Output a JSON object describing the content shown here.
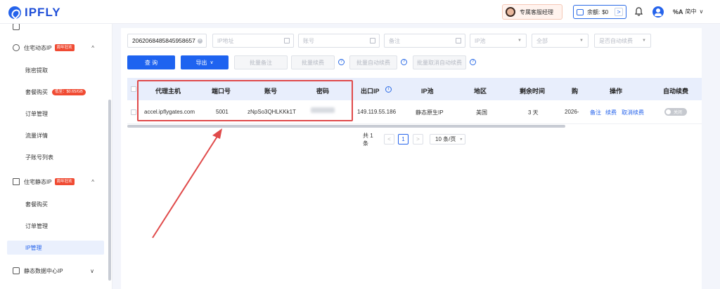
{
  "header": {
    "logo_text": "IPFLY",
    "service_label": "专属客服经理",
    "balance_label": "余额:",
    "balance_value": "$0",
    "balance_arrow": ">",
    "language": "简中",
    "language_icon": "%A",
    "language_caret": "∨"
  },
  "sidebar": {
    "groups": [
      {
        "label": "住宅动态IP",
        "badge": "周年狂欢",
        "caret": "^"
      },
      {
        "label": "住宅静态IP",
        "badge": "周年狂欢",
        "caret": "^"
      },
      {
        "label": "静态数据中心IP",
        "caret": "∨"
      }
    ],
    "dynamic_items": [
      "账密提取",
      "套餐购买",
      "订单管理",
      "流量详情",
      "子账号列表"
    ],
    "dynamic_pill": "低至：$0.65/GB",
    "static_items": [
      "套餐购买",
      "订单管理",
      "IP管理"
    ]
  },
  "filters": {
    "order_value": "2062068485845958657",
    "ip_placeholder": "IP地址",
    "account_placeholder": "账号",
    "remark_placeholder": "备注",
    "pool_placeholder": "IP池",
    "all_placeholder": "全部",
    "autorenew_placeholder": "是否自动续费"
  },
  "toolbar": {
    "query": "查 询",
    "export": "导出",
    "export_caret": "∨",
    "batch_remark": "批量备注",
    "batch_renew": "批量续费",
    "batch_autorenew": "批量自动续费",
    "batch_cancel_autorenew": "批量取消自动续费",
    "help_glyph": "?"
  },
  "table": {
    "headers": [
      "代理主机",
      "端口号",
      "账号",
      "密码",
      "出口IP",
      "IP池",
      "地区",
      "剩余时间",
      "购",
      "操作",
      "自动续费"
    ],
    "info_glyph": "i",
    "row": {
      "host": "accel.ipflygates.com",
      "port": "5001",
      "account": "zNpSo3QHLKKk1T",
      "exit_ip": "149.119.55.186",
      "pool": "静态原生IP",
      "region": "美国",
      "remaining": "3 天",
      "purchase": "2026-",
      "action_remark": "备注",
      "action_renew": "续费",
      "action_cancel": "取消续费",
      "autorenew_toggle": "关闭"
    }
  },
  "pagination": {
    "total": "共 1 条",
    "prev": "<",
    "current": "1",
    "next": ">",
    "page_size": "10 条/页"
  }
}
